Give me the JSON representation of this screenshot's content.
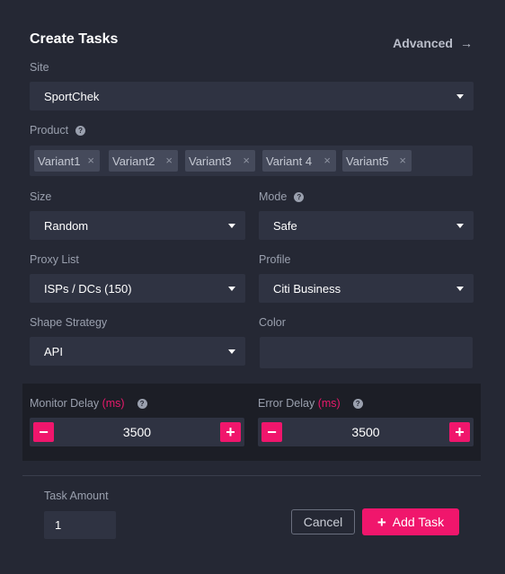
{
  "modal": {
    "title": "Create Tasks",
    "advanced_label": "Advanced",
    "advanced_icon": "arrow-right-icon"
  },
  "site": {
    "label": "Site",
    "value": "SportChek"
  },
  "product": {
    "label": "Product",
    "help_icon": "?",
    "tags": [
      "Variant1",
      "Variant2",
      "Variant3",
      "Variant 4",
      "Variant5"
    ]
  },
  "size": {
    "label": "Size",
    "value": "Random"
  },
  "mode": {
    "label": "Mode",
    "help_icon": "?",
    "value": "Safe"
  },
  "proxy_list": {
    "label": "Proxy List",
    "value": "ISPs / DCs (150)"
  },
  "profile": {
    "label": "Profile",
    "value": "Citi Business"
  },
  "shape_strategy": {
    "label": "Shape Strategy",
    "value": "API"
  },
  "color": {
    "label": "Color",
    "value": ""
  },
  "monitor_delay": {
    "label": "Monitor Delay",
    "unit": "(ms)",
    "help_icon": "?",
    "value": "3500",
    "decrement": "−",
    "increment": "+"
  },
  "error_delay": {
    "label": "Error Delay",
    "unit": "(ms)",
    "help_icon": "?",
    "value": "3500",
    "decrement": "−",
    "increment": "+"
  },
  "task_amount": {
    "label": "Task Amount",
    "value": "1"
  },
  "actions": {
    "cancel_label": "Cancel",
    "add_label": "Add Task",
    "add_icon": "+"
  },
  "colors": {
    "accent": "#f0166c",
    "background": "#252834",
    "field": "#2f3342",
    "section": "#1c1e26"
  }
}
